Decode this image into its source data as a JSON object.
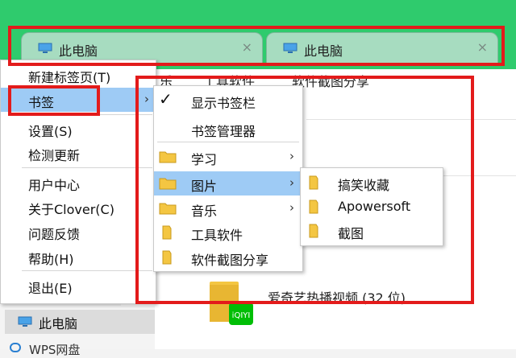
{
  "tabs": [
    {
      "label": "此电脑",
      "close": "×"
    },
    {
      "label": "此电脑",
      "close": "×"
    }
  ],
  "address_row": {
    "item1": "乐",
    "item2": "工具软件",
    "item3": "软件截图分享"
  },
  "context_menu": {
    "items": [
      {
        "label": "新建标签页(T)"
      },
      {
        "label": "书签",
        "arrow": "›"
      },
      {
        "label": "设置(S)"
      },
      {
        "label": "检测更新"
      },
      {
        "label": "用户中心"
      },
      {
        "label": "关于Clover(C)"
      },
      {
        "label": "问题反馈"
      },
      {
        "label": "帮助(H)"
      },
      {
        "label": "退出(E)"
      }
    ]
  },
  "bookmarks_menu": {
    "check": "✓",
    "items": [
      {
        "label": "显示书签栏"
      },
      {
        "label": "书签管理器"
      },
      {
        "label": "学习",
        "arrow": "›"
      },
      {
        "label": "图片",
        "arrow": "›"
      },
      {
        "label": "音乐",
        "arrow": "›"
      },
      {
        "label": "工具软件"
      },
      {
        "label": "软件截图分享"
      }
    ]
  },
  "pictures_menu": {
    "items": [
      {
        "label": "搞笑收藏"
      },
      {
        "label": "Apowersoft"
      },
      {
        "label": "截图"
      }
    ]
  },
  "nav": {
    "this_pc": "此电脑",
    "wps": "WPS网盘"
  },
  "content": {
    "iqiyi_label": "爱奇艺热播视频 (32 位)",
    "iqiyi_badge": "iQIYI"
  },
  "colors": {
    "title_green": "#2fcb6d",
    "tab_bg": "#a7dcc0",
    "highlight": "#9ecbf5",
    "annotation_red": "#e31b1b",
    "folder_yellow": "#f4c642"
  }
}
